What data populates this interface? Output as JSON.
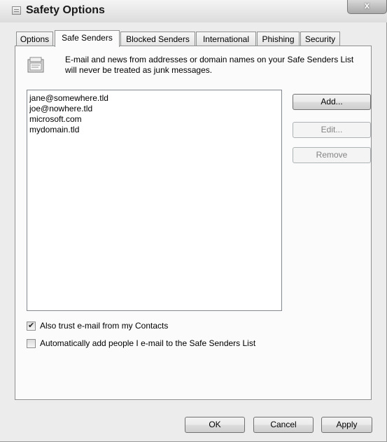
{
  "window": {
    "title": "Safety Options",
    "close_label": "x"
  },
  "tabs": [
    {
      "label": "Options",
      "active": false
    },
    {
      "label": "Safe Senders",
      "active": true
    },
    {
      "label": "Blocked Senders",
      "active": false
    },
    {
      "label": "International",
      "active": false
    },
    {
      "label": "Phishing",
      "active": false
    },
    {
      "label": "Security",
      "active": false
    }
  ],
  "panel": {
    "description": "E-mail and news from addresses or domain names on your Safe Senders List will never be treated as junk messages.",
    "safe_senders": [
      "jane@somewhere.tld",
      "joe@nowhere.tld",
      "microsoft.com",
      "mydomain.tld"
    ],
    "buttons": {
      "add": "Add...",
      "edit": "Edit...",
      "remove": "Remove"
    },
    "checkboxes": {
      "trust_contacts": {
        "label": "Also trust e-mail from my Contacts",
        "checked": true
      },
      "auto_add": {
        "label": "Automatically add people I e-mail to the Safe Senders List",
        "checked": false
      }
    }
  },
  "footer": {
    "ok": "OK",
    "cancel": "Cancel",
    "apply": "Apply"
  }
}
